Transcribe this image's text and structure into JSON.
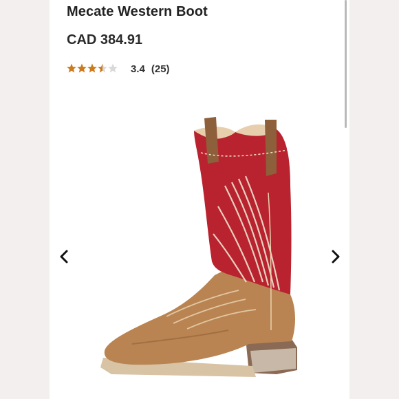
{
  "product": {
    "title": "Mecate Western Boot",
    "price": "CAD 384.91",
    "rating": {
      "value": "3.4",
      "count": "(25)",
      "stars_filled": 3.4,
      "stars_max": 5
    },
    "image_alt": "red and tan western boot"
  },
  "icons": {
    "prev": "chevron-left-icon",
    "next": "chevron-right-icon",
    "star": "star-icon"
  },
  "colors": {
    "star_filled": "#cc7a1c",
    "star_empty": "#d9d9d9",
    "boot_shaft": "#b8232f",
    "boot_foot": "#b98452"
  }
}
